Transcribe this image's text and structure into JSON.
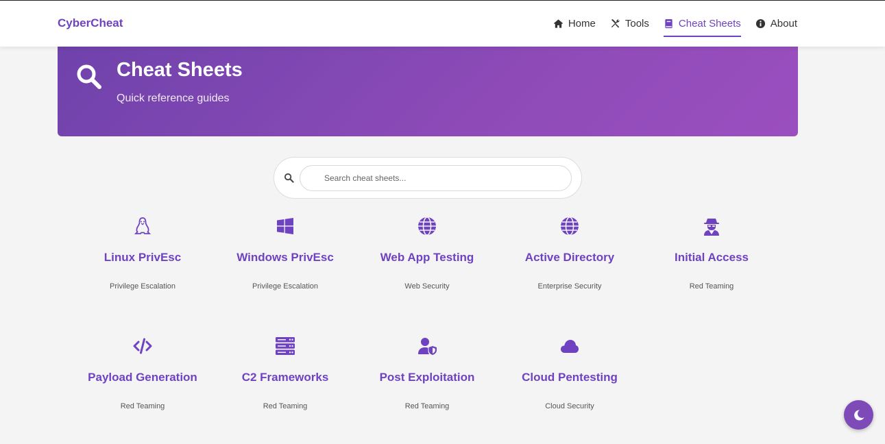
{
  "brand": "CyberCheat",
  "nav": [
    {
      "label": "Home",
      "icon": "home-icon"
    },
    {
      "label": "Tools",
      "icon": "tools-icon"
    },
    {
      "label": "Cheat Sheets",
      "icon": "book-icon",
      "active": true
    },
    {
      "label": "About",
      "icon": "info-icon"
    }
  ],
  "hero": {
    "title": "Cheat Sheets",
    "subtitle": "Quick reference guides",
    "icon": "search-icon"
  },
  "search": {
    "placeholder": "Search cheat sheets...",
    "value": ""
  },
  "cards": [
    {
      "title": "Linux PrivEsc",
      "category": "Privilege Escalation",
      "icon": "linux-icon"
    },
    {
      "title": "Windows PrivEsc",
      "category": "Privilege Escalation",
      "icon": "windows-icon"
    },
    {
      "title": "Web App Testing",
      "category": "Web Security",
      "icon": "globe-icon"
    },
    {
      "title": "Active Directory",
      "category": "Enterprise Security",
      "icon": "globe-icon"
    },
    {
      "title": "Initial Access",
      "category": "Red Teaming",
      "icon": "spy-icon"
    },
    {
      "title": "Payload Generation",
      "category": "Red Teaming",
      "icon": "code-icon"
    },
    {
      "title": "C2 Frameworks",
      "category": "Red Teaming",
      "icon": "server-icon"
    },
    {
      "title": "Post Exploitation",
      "category": "Red Teaming",
      "icon": "user-shield-icon"
    },
    {
      "title": "Cloud Pentesting",
      "category": "Cloud Security",
      "icon": "cloud-icon"
    }
  ],
  "theme_toggle_icon": "moon-icon",
  "colors": {
    "accent": "#6f42c1",
    "hero_start": "#6f42ab",
    "hero_end": "#9b4fbf",
    "background": "#f4f4f4"
  }
}
